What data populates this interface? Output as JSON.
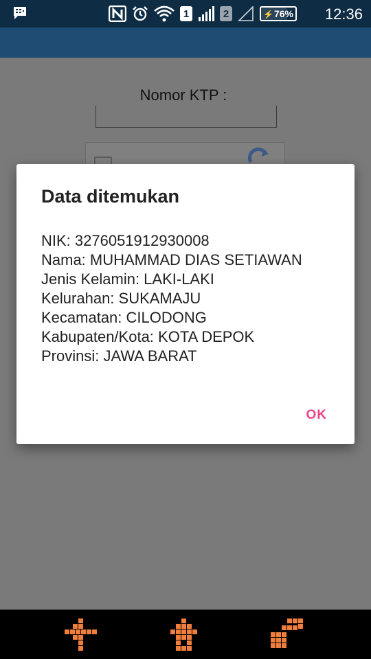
{
  "status_bar": {
    "sim1_label": "1",
    "sim2_label": "2",
    "battery_percent": "76%",
    "time": "12:36",
    "icons": [
      "bbm-icon",
      "nfc-icon",
      "alarm-icon",
      "wifi-icon",
      "signal-sim1-icon",
      "signal-sim2-icon",
      "battery-icon"
    ]
  },
  "form": {
    "ktp_label": "Nomor KTP :",
    "ktp_value": ""
  },
  "dialog": {
    "title": "Data ditemukan",
    "lines": [
      "NIK: 3276051912930008",
      "Nama: MUHAMMAD DIAS SETIAWAN",
      "Jenis Kelamin: LAKI-LAKI",
      "Kelurahan: SUKAMAJU",
      "Kecamatan: CILODONG",
      "Kabupaten/Kota: KOTA DEPOK",
      "Provinsi: JAWA BARAT"
    ],
    "ok_label": "OK"
  },
  "colors": {
    "status_bar": "#0e2c44",
    "app_bar": "#1e4c72",
    "accent": "#ee4186",
    "nav_key": "#f07e3c"
  }
}
